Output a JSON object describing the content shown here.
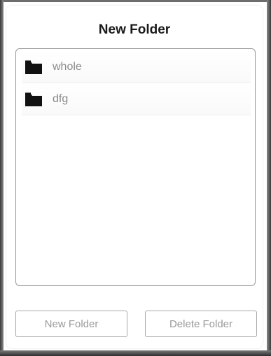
{
  "dialog": {
    "title": "New Folder"
  },
  "folders": [
    {
      "label": "whole",
      "icon": "folder-icon"
    },
    {
      "label": "dfg",
      "icon": "folder-icon"
    }
  ],
  "buttons": {
    "new_folder_label": "New Folder",
    "delete_folder_label": "Delete Folder"
  },
  "colors": {
    "title_text": "#1a1a1a",
    "item_text": "#8a8a8a",
    "button_text": "#9a9a9a",
    "border": "#9a9a9a"
  }
}
